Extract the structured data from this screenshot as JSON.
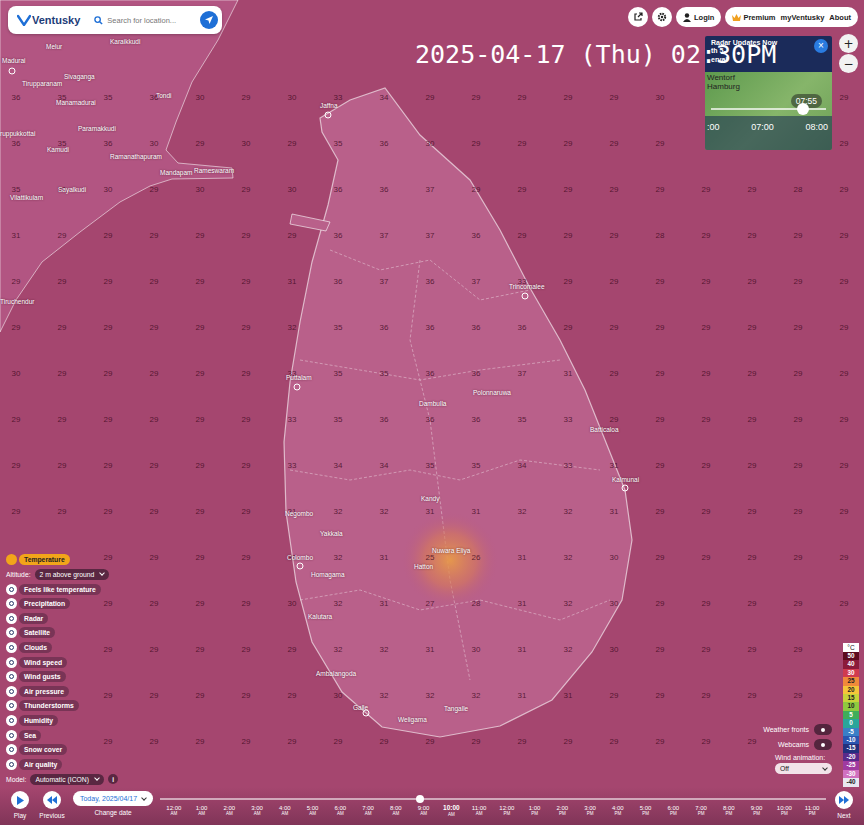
{
  "header": {
    "logo": "Ventusky",
    "search_placeholder": "Search for location...",
    "nav": [
      "Login",
      "Premium",
      "myVentusky",
      "About"
    ]
  },
  "zoom": [
    "+",
    "−"
  ],
  "timestamp": "2025-04-17 (Thu) 02:30PM",
  "radar_popup": {
    "title_lines": [
      "Radar Updates Now",
      "th 5-",
      "erval"
    ],
    "close": "×",
    "places": [
      "Wentorf",
      "Hamburg"
    ],
    "bubble": "07:55",
    "times": [
      ":00",
      "07:00",
      "08:00"
    ],
    "level": 0.8
  },
  "layers": {
    "items": [
      {
        "label": "Temperature",
        "selected": true
      },
      {
        "label": "Feels like temperature",
        "selected": false
      },
      {
        "label": "Precipitation",
        "selected": false
      },
      {
        "label": "Radar",
        "selected": false
      },
      {
        "label": "Satellite",
        "selected": false
      },
      {
        "label": "Clouds",
        "selected": false
      },
      {
        "label": "Wind speed",
        "selected": false
      },
      {
        "label": "Wind gusts",
        "selected": false
      },
      {
        "label": "Air pressure",
        "selected": false
      },
      {
        "label": "Thunderstorms",
        "selected": false
      },
      {
        "label": "Humidity",
        "selected": false
      },
      {
        "label": "Sea",
        "selected": false
      },
      {
        "label": "Snow cover",
        "selected": false
      },
      {
        "label": "Air quality",
        "selected": false
      }
    ],
    "altitude_label": "Altitude:",
    "altitude": "2 m above ground",
    "model_label": "Model:",
    "model": "Automatic (ICON)",
    "info": "i"
  },
  "legend": {
    "unit": "°C",
    "steps": [
      {
        "label": "50",
        "color": "#5c0a1e"
      },
      {
        "label": "40",
        "color": "#8b1a3a"
      },
      {
        "label": "30",
        "color": "#d03a4f"
      },
      {
        "label": "25",
        "color": "#f08a3a"
      },
      {
        "label": "20",
        "color": "#f5c53a"
      },
      {
        "label": "15",
        "color": "#c8d23a"
      },
      {
        "label": "10",
        "color": "#8fc93f"
      },
      {
        "label": "5",
        "color": "#3fae5a"
      },
      {
        "label": "0",
        "color": "#2aa59a"
      },
      {
        "label": "-5",
        "color": "#3a7fc6"
      },
      {
        "label": "-10",
        "color": "#2a55b0"
      },
      {
        "label": "-15",
        "color": "#23307d"
      },
      {
        "label": "-20",
        "color": "#5a2a8a"
      },
      {
        "label": "-25",
        "color": "#a03aa0"
      },
      {
        "label": "-30",
        "color": "#d070c0"
      },
      {
        "label": "-40",
        "color": "#e8e8f0"
      }
    ]
  },
  "toggles": [
    {
      "label": "Weather fronts",
      "on": false
    },
    {
      "label": "Webcams",
      "on": false
    }
  ],
  "wind_animation": {
    "label": "Wind animation:",
    "value": "Off"
  },
  "map": {
    "cities": [
      {
        "name": "Madurai",
        "marker": true
      },
      {
        "name": "Melur",
        "marker": false
      },
      {
        "name": "Karaikkudi",
        "marker": false
      },
      {
        "name": "Sivaganga",
        "marker": false
      },
      {
        "name": "Tirupparanam",
        "marker": false
      },
      {
        "name": "Manamadurai",
        "marker": false
      },
      {
        "name": "Paramakkudi",
        "marker": false
      },
      {
        "name": "ruppukkottai",
        "marker": false
      },
      {
        "name": "Kamudi",
        "marker": false
      },
      {
        "name": "Tondi",
        "marker": false
      },
      {
        "name": "Ramanathapuram",
        "marker": false
      },
      {
        "name": "Mandapam",
        "marker": false
      },
      {
        "name": "Rameswaram",
        "marker": false
      },
      {
        "name": "Sayalkudi",
        "marker": false
      },
      {
        "name": "Vilattikulam",
        "marker": false
      },
      {
        "name": "Tiruchendur",
        "marker": false
      },
      {
        "name": "Jaffna",
        "marker": true
      },
      {
        "name": "Trincomalee",
        "marker": true
      },
      {
        "name": "Puttalam",
        "marker": true
      },
      {
        "name": "Dambulla",
        "marker": false
      },
      {
        "name": "Polonnaruwa",
        "marker": false
      },
      {
        "name": "Batticaloa",
        "marker": false
      },
      {
        "name": "Kalmunai",
        "marker": true
      },
      {
        "name": "Kandy",
        "marker": false
      },
      {
        "name": "Negombo",
        "marker": false
      },
      {
        "name": "Yakkala",
        "marker": false
      },
      {
        "name": "Colombo",
        "marker": true
      },
      {
        "name": "Nuwara Eliya",
        "marker": false
      },
      {
        "name": "Hatton",
        "marker": false
      },
      {
        "name": "Homagama",
        "marker": false
      },
      {
        "name": "Kalutara",
        "marker": false
      },
      {
        "name": "Ambalangoda",
        "marker": false
      },
      {
        "name": "Galle",
        "marker": true
      },
      {
        "name": "Weligama",
        "marker": false
      },
      {
        "name": "Tangalle",
        "marker": false
      }
    ],
    "temperature_grid": [
      [
        "36",
        "35",
        "35",
        "36",
        "30",
        "29",
        "30",
        "33",
        "34",
        "29",
        "29",
        "29",
        "29",
        "29",
        "30",
        null,
        null,
        null,
        "29"
      ],
      [
        "36",
        "35",
        "36",
        "30",
        "29",
        "30",
        "29",
        "35",
        "36",
        "30",
        "29",
        "29",
        "29",
        "29",
        "29",
        null,
        null,
        null,
        "29"
      ],
      [
        "35",
        "31",
        "30",
        "29",
        "30",
        "29",
        "30",
        "36",
        "36",
        "37",
        "29",
        "29",
        "29",
        "29",
        "29",
        "29",
        "29",
        "28",
        "29"
      ],
      [
        "31",
        "29",
        "29",
        "29",
        "29",
        "29",
        "29",
        "36",
        "37",
        "37",
        "36",
        "29",
        "29",
        "29",
        "28",
        "29",
        "29",
        "29",
        "29"
      ],
      [
        "29",
        "29",
        "29",
        "29",
        "29",
        "29",
        "31",
        "36",
        "37",
        "36",
        "37",
        "33",
        "29",
        "29",
        "29",
        "29",
        "29",
        "29",
        "29"
      ],
      [
        "29",
        "29",
        "29",
        "29",
        "29",
        "29",
        "32",
        "35",
        "36",
        "36",
        "36",
        "36",
        "29",
        "29",
        "29",
        "29",
        "29",
        "29",
        "29"
      ],
      [
        "30",
        "29",
        "29",
        "29",
        "29",
        "29",
        "33",
        "35",
        "35",
        "36",
        "36",
        "37",
        "31",
        "29",
        "29",
        "29",
        "29",
        "29",
        "29"
      ],
      [
        "29",
        "29",
        "29",
        "29",
        "29",
        "29",
        "33",
        "35",
        "36",
        "36",
        "36",
        "35",
        "33",
        "29",
        "29",
        "29",
        "29",
        "29",
        "29"
      ],
      [
        "29",
        "29",
        "29",
        "29",
        "29",
        "29",
        "33",
        "34",
        "34",
        "35",
        "35",
        "34",
        "33",
        "31",
        "29",
        "29",
        "29",
        "29",
        "29"
      ],
      [
        "29",
        "29",
        "29",
        "29",
        "29",
        "29",
        "31",
        "32",
        "32",
        "31",
        "31",
        "32",
        "32",
        "31",
        "29",
        "29",
        "29",
        "29",
        "29"
      ],
      [
        null,
        null,
        "29",
        "29",
        "29",
        "29",
        "31",
        "32",
        "31",
        "25",
        "26",
        "31",
        "32",
        "30",
        "29",
        "29",
        "29",
        "29",
        "29"
      ],
      [
        null,
        null,
        "29",
        "29",
        "29",
        "29",
        "30",
        "32",
        "31",
        "27",
        "28",
        "31",
        "32",
        "30",
        "29",
        "29",
        "29",
        "29",
        "29"
      ],
      [
        null,
        null,
        "29",
        "29",
        "29",
        "29",
        "29",
        "32",
        "32",
        "31",
        "30",
        "31",
        "32",
        "30",
        "29",
        "29",
        "29",
        "29",
        null
      ],
      [
        null,
        null,
        "29",
        "29",
        "29",
        "29",
        "29",
        "30",
        "32",
        "32",
        "32",
        "31",
        "31",
        "29",
        "29",
        "29",
        "29",
        "29",
        null
      ],
      [
        null,
        null,
        "29",
        "29",
        "29",
        "29",
        "29",
        "29",
        "29",
        "29",
        "29",
        "29",
        "29",
        "29",
        "29",
        "29",
        "29",
        null,
        null
      ]
    ]
  },
  "bottom_bar": {
    "play": "Play",
    "previous": "Previous",
    "date": "Today, 2025/04/17",
    "change_date": "Change date",
    "next": "Next",
    "level": 0.39,
    "hours": [
      {
        "time": "12:00",
        "period": "AM",
        "selected": false
      },
      {
        "time": "1:00",
        "period": "AM",
        "selected": false
      },
      {
        "time": "2:00",
        "period": "AM",
        "selected": false
      },
      {
        "time": "3:00",
        "period": "AM",
        "selected": false
      },
      {
        "time": "4:00",
        "period": "AM",
        "selected": false
      },
      {
        "time": "5:00",
        "period": "AM",
        "selected": false
      },
      {
        "time": "6:00",
        "period": "AM",
        "selected": false
      },
      {
        "time": "7:00",
        "period": "AM",
        "selected": false
      },
      {
        "time": "8:00",
        "period": "AM",
        "selected": false
      },
      {
        "time": "9:00",
        "period": "AM",
        "selected": false
      },
      {
        "time": "10:00",
        "period": "AM",
        "selected": true
      },
      {
        "time": "11:00",
        "period": "AM",
        "selected": false
      },
      {
        "time": "12:00",
        "period": "PM",
        "selected": false
      },
      {
        "time": "1:00",
        "period": "PM",
        "selected": false
      },
      {
        "time": "2:00",
        "period": "PM",
        "selected": false
      },
      {
        "time": "3:00",
        "period": "PM",
        "selected": false
      },
      {
        "time": "4:00",
        "period": "PM",
        "selected": false
      },
      {
        "time": "5:00",
        "period": "PM",
        "selected": false
      },
      {
        "time": "6:00",
        "period": "PM",
        "selected": false
      },
      {
        "time": "7:00",
        "period": "PM",
        "selected": false
      },
      {
        "time": "8:00",
        "period": "PM",
        "selected": false
      },
      {
        "time": "9:00",
        "period": "PM",
        "selected": false
      },
      {
        "time": "10:00",
        "period": "PM",
        "selected": false
      },
      {
        "time": "11:00",
        "period": "PM",
        "selected": false
      }
    ]
  }
}
